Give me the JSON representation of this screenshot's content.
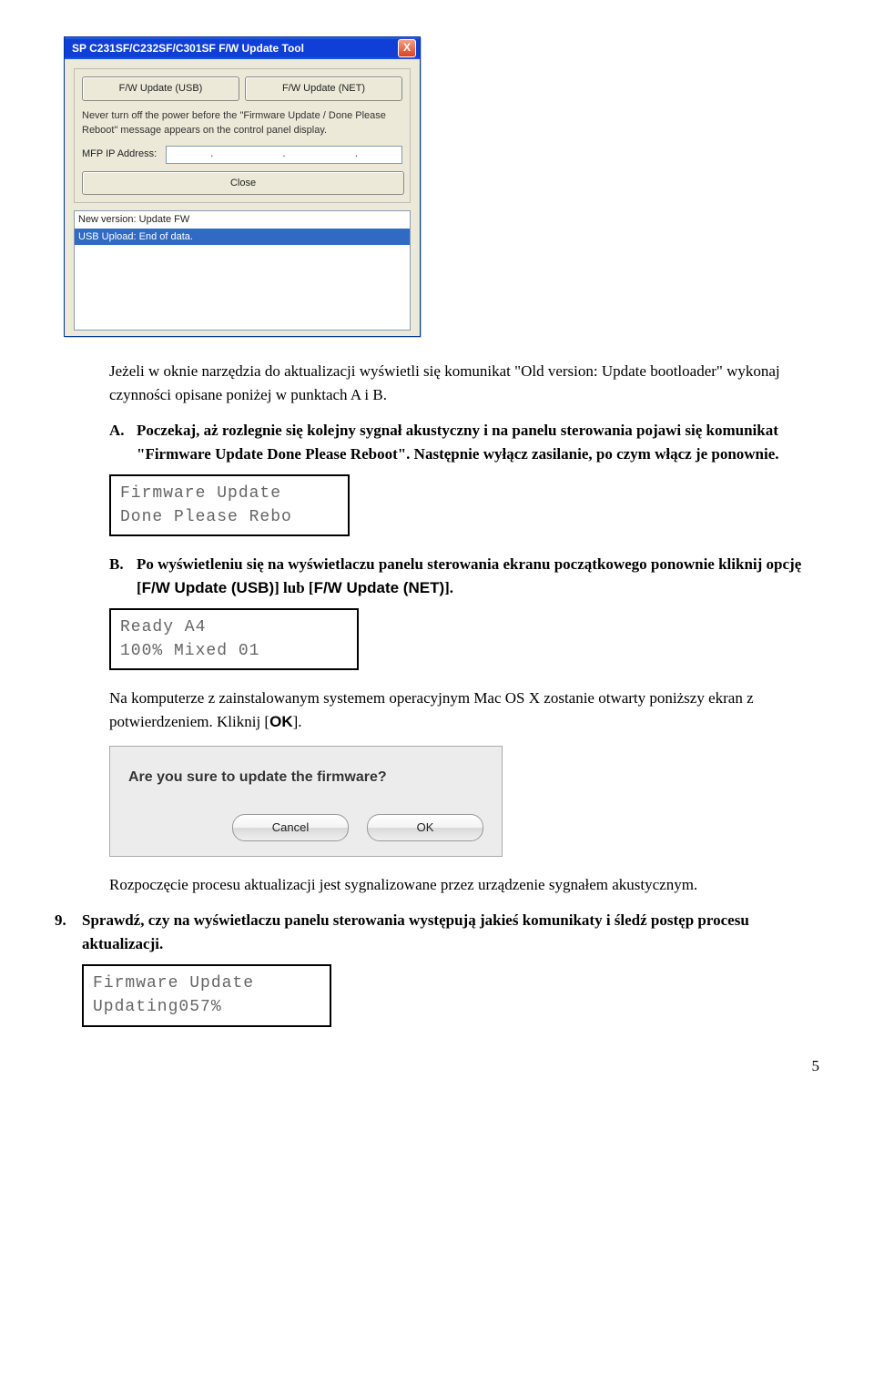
{
  "xp_window": {
    "title": "SP C231SF/C232SF/C301SF F/W Update Tool",
    "close_glyph": "X",
    "btn_usb": "F/W Update (USB)",
    "btn_net": "F/W Update (NET)",
    "warning": "Never turn off the power before the \"Firmware Update / Done Please Reboot\" message appears on the control panel display.",
    "ip_label": "MFP IP Address:",
    "ip_dots": [
      ".",
      ".",
      "."
    ],
    "btn_close": "Close",
    "list_rows": [
      "New version: Update FW",
      "USB Upload: End of data."
    ]
  },
  "para1": "Jeżeli w oknie narzędzia do aktualizacji wyświetli się komunikat \"Old version: Update bootloader\" wykonaj czynności opisane poniżej w punktach A i B.",
  "stepA": {
    "marker": "A.",
    "text_before": "Poczekaj, aż rozlegnie się kolejny sygnał akustyczny i na panelu sterowania pojawi się komunikat ",
    "msg": "\"Firmware Update Done Please Reboot\"",
    "text_after": ". Następnie wyłącz zasilanie, po czym włącz je ponownie."
  },
  "lcd1_line1": "Firmware Update",
  "lcd1_line2": "Done Please Rebo",
  "stepB": {
    "marker": "B.",
    "text_before": "Po wyświetleniu się na wyświetlaczu panelu sterowania ekranu początkowego ponownie kliknij opcję [",
    "opt1": "F/W Update (USB)",
    "joiner": "] lub [",
    "opt2": "F/W Update (NET)",
    "text_after": "]."
  },
  "lcd2_line1": "Ready    A4",
  "lcd2_line2": "100% Mixed   01",
  "para2_before": "Na komputerze z zainstalowanym systemem operacyjnym Mac OS X zostanie otwarty poniższy ekran z potwierdzeniem. Kliknij [",
  "ok_label": "OK",
  "para2_after": "].",
  "mac_dialog": {
    "title": "Are you sure to update the firmware?",
    "cancel": "Cancel",
    "ok": "OK"
  },
  "para3": "Rozpoczęcie procesu aktualizacji jest sygnalizowane przez urządzenie sygnałem akustycznym.",
  "step9": {
    "marker": "9.",
    "text": "Sprawdź, czy na wyświetlaczu panelu sterowania występują jakieś komunikaty i śledź postęp procesu aktualizacji."
  },
  "lcd3_line1": "Firmware Update",
  "lcd3_line2": "Updating057%",
  "page_number": "5"
}
